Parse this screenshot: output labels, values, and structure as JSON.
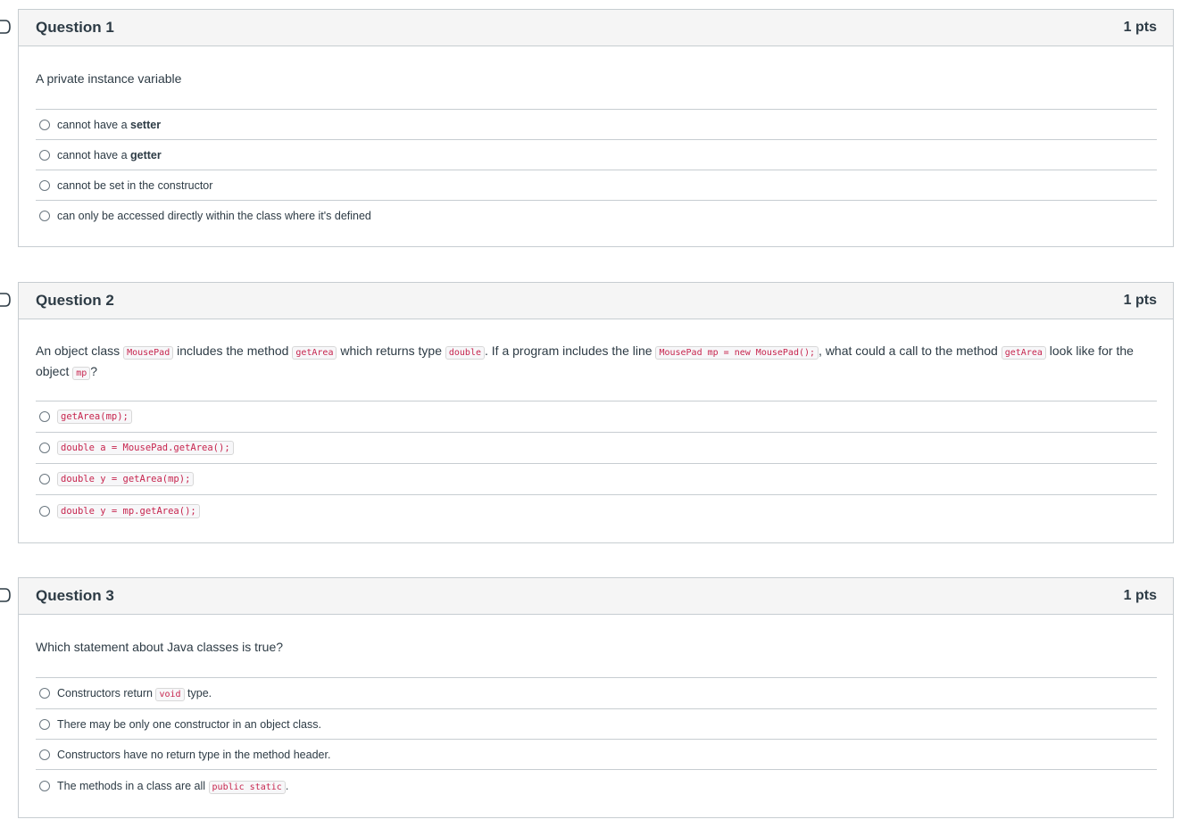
{
  "questions": [
    {
      "title": "Question 1",
      "points": "1 pts",
      "prompt": "A private instance variable",
      "answers": [
        {
          "prefix": "cannot have a ",
          "bold": "setter"
        },
        {
          "prefix": "cannot have a ",
          "bold": "getter"
        },
        {
          "text": "cannot be set in the constructor"
        },
        {
          "text": "can only be accessed directly within the class where it's defined"
        }
      ]
    },
    {
      "title": "Question 2",
      "points": "1 pts",
      "prompt_parts": {
        "p1": "An object class ",
        "c1": "MousePad",
        "p2": " includes the method ",
        "c2": "getArea",
        "p3": " which returns type ",
        "c3": "double",
        "p4": ". If a program includes the line ",
        "c4": "MousePad mp = new MousePad();",
        "p5": ", what could a call to the method ",
        "c5": "getArea",
        "p6": " look like for the object ",
        "c6": "mp",
        "p7": "?"
      },
      "answers": [
        {
          "code": "getArea(mp);"
        },
        {
          "code": "double a = MousePad.getArea();"
        },
        {
          "code": "double y = getArea(mp);"
        },
        {
          "code": "double y = mp.getArea();"
        }
      ]
    },
    {
      "title": "Question 3",
      "points": "1 pts",
      "prompt": "Which statement about Java classes is true?",
      "answers": [
        {
          "prefix": "Constructors return ",
          "code": "void",
          "suffix": " type."
        },
        {
          "text": "There may be only one constructor in an object class."
        },
        {
          "text": "Constructors have no return type in the method header."
        },
        {
          "prefix": "The methods in a class are all ",
          "code": "public static",
          "suffix": "."
        }
      ]
    }
  ],
  "icons": {
    "flag": "flag-question-icon",
    "radio": "radio-button-icon"
  },
  "colors": {
    "header_bg": "#f5f5f5",
    "border": "#c7cdd1",
    "code_text": "#c7254e",
    "text": "#2d3b45"
  }
}
